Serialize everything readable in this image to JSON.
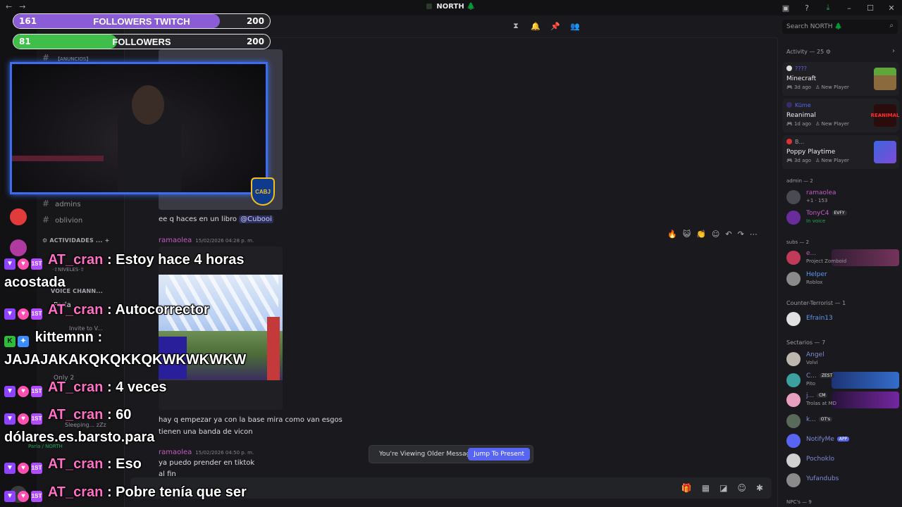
{
  "window": {
    "server_name": "NORTH 🌲"
  },
  "channels": {
    "anuncios": "【ANUNCIOS】",
    "admins": "admins",
    "oblivion": "oblivion",
    "cat_actividades": "ACTIVIDADES ...",
    "niveles": "·⇧NIVELES·⇧",
    "cat_voice": "VOICE CHANN...",
    "parla": "Parla",
    "invite": "Invite to V...",
    "only2": "Only 2",
    "sleeping": "Sleeping... zZz",
    "footer": "Parla / NORTH"
  },
  "header": {
    "search_placeholder": "Search NORTH 🌲"
  },
  "messages": {
    "m1_text": "ee q haces en un libro",
    "m1_mention": "@Cubooi",
    "m2_author": "ramaolea",
    "m2_time": "15/02/2026 04:28 p. m.",
    "m3_text": "hay q empezar ya con la base mira como van esgos",
    "m4_text": "tienen una banda de vicon",
    "m5_author": "ramaolea",
    "m5_time": "15/02/2026 04:50 p. m.",
    "m5_text": "ya puedo prender en tiktok",
    "m6_text": "al fin"
  },
  "older_bar": {
    "text": "You're Viewing Older Messages",
    "jump_label": "Jump To Present"
  },
  "side": {
    "activity_head": "Activity — 25",
    "activities": [
      {
        "user": "????",
        "game": "Minecraft",
        "time": "3d ago",
        "status": "New Player"
      },
      {
        "user": "Küme",
        "game": "Reanimal",
        "time": "1d ago",
        "status": "New Player"
      },
      {
        "user": "B...",
        "game": "Poppy Playtime",
        "time": "3d ago",
        "status": "New Player"
      }
    ],
    "reanimal_logo": "REANIMAL",
    "admin_head": "admin — 2",
    "subs_head": "subs — 2",
    "ct_head": "Counter-Terrorist — 1",
    "sect_head": "Sectarios — 7",
    "npc_head": "NPC's — 9",
    "members": {
      "ramaolea": {
        "name": "ramaolea",
        "sub": "+1 · 153",
        "color": "#c05cc0"
      },
      "tony": {
        "name": "TonyC4",
        "tag": "EVFY",
        "sub": "In voice",
        "color": "#c05cc0"
      },
      "e": {
        "name": "e...",
        "sub": "Project Zomboid",
        "color": "#c05cc0"
      },
      "helper": {
        "name": "Helper",
        "sub": "Roblox",
        "color": "#5a9cf0"
      },
      "efrain": {
        "name": "Efrain13",
        "color": "#5a9cf0"
      },
      "angel": {
        "name": "Angel",
        "sub": "Volvi",
        "color": "#7e8ad6"
      },
      "c": {
        "name": "C...",
        "tag": "ZEST",
        "sub": "Pito",
        "color": "#7e8ad6"
      },
      "j": {
        "name": "j...",
        "tag": "CM",
        "sub": "Trolas at MD",
        "color": "#7e8ad6"
      },
      "k": {
        "name": "k...",
        "tag": "OT's",
        "color": "#7e8ad6"
      },
      "notify": {
        "name": "NotifyMe",
        "tag": "APP",
        "color": "#7e8ad6"
      },
      "pochoklo": {
        "name": "Pochoklo",
        "color": "#7e8ad6"
      },
      "yufandubs": {
        "name": "Yufandubs",
        "color": "#7e8ad6"
      }
    }
  },
  "overlay": {
    "bar1": {
      "count": "161",
      "label": "FOLLOWERS TWITCH",
      "goal": "200",
      "progress": 0.805,
      "color": "#8a5cd6"
    },
    "bar2": {
      "count": "81",
      "label": "FOLLOWERS",
      "goal": "200",
      "progress": 0.405,
      "color": "#3fbf4a"
    },
    "cabj": "CABJ",
    "chat": [
      {
        "user": "AT_cran",
        "text": ": Estoy hace 4 horas",
        "cont": "acostada"
      },
      {
        "user": "AT_cran",
        "text": ": Autocorrector"
      },
      {
        "user": "kittemnn",
        "text": ":",
        "cont": "JAJAJAKAKQKQKKQKWKWKWKW"
      },
      {
        "user": "AT_cran",
        "text": ": 4 veces"
      },
      {
        "user": "AT_cran",
        "text": ": 60",
        "cont": "dólares.es.barsto.para"
      },
      {
        "user": "AT_cran",
        "text": ": Eso"
      },
      {
        "user": "AT_cran",
        "text": ": Pobre tenía que ser"
      }
    ],
    "badge_1st": "1ST",
    "badge_k": "K"
  }
}
